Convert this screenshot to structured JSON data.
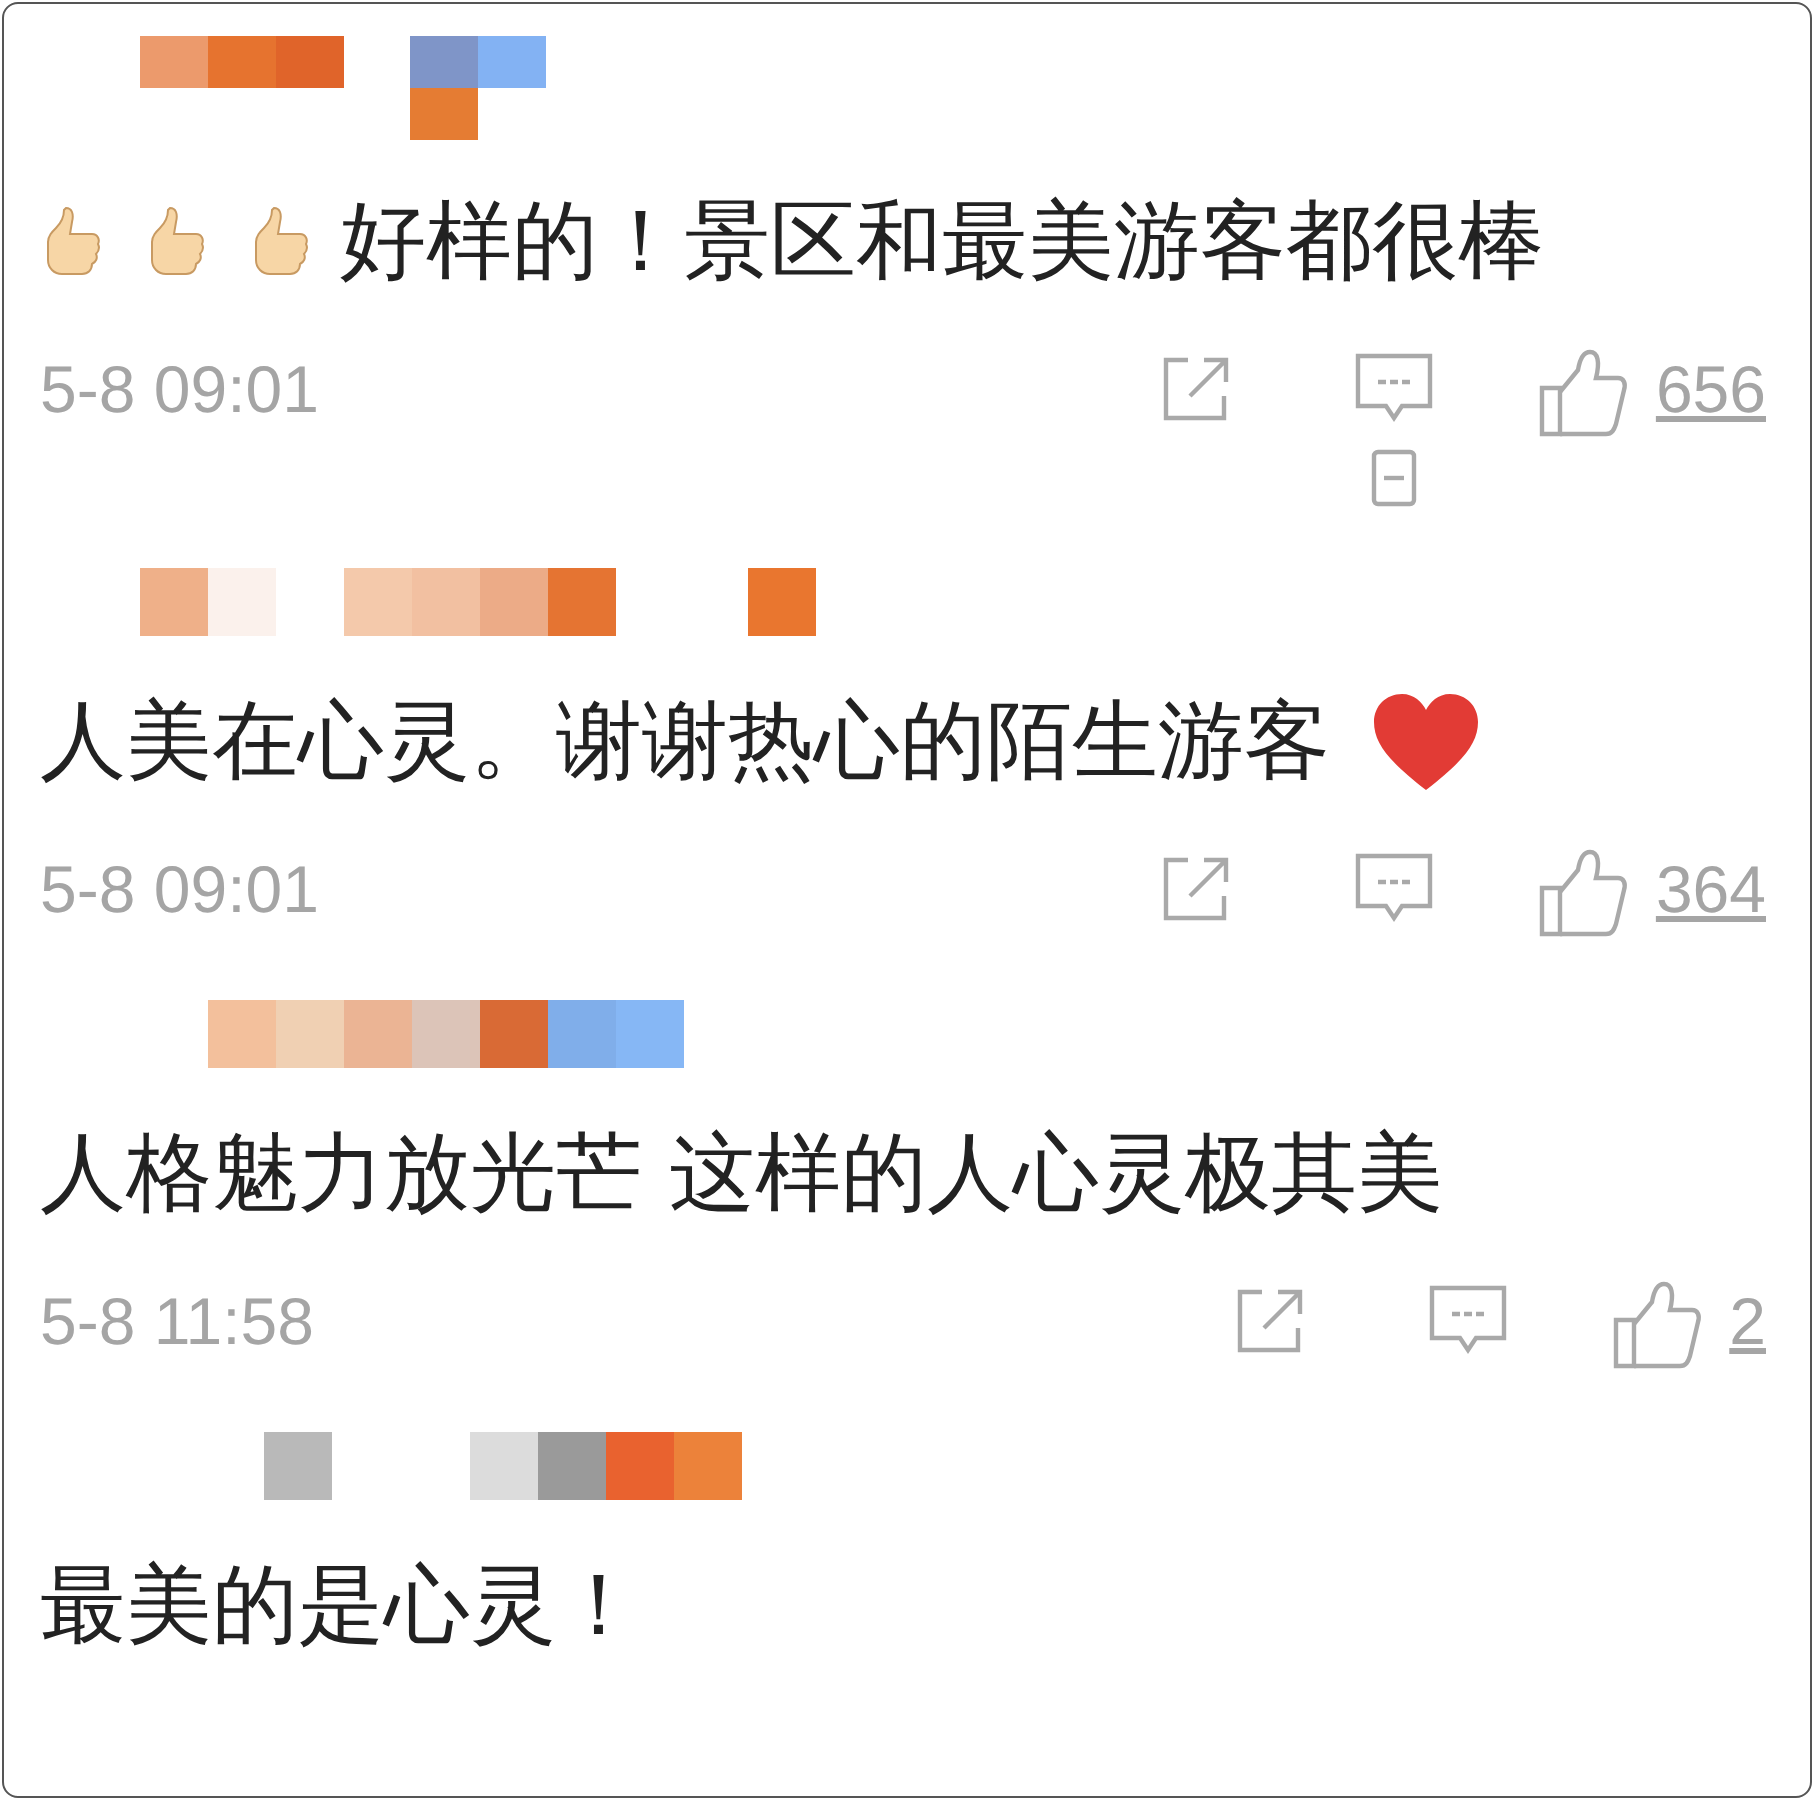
{
  "comments": [
    {
      "author": {
        "kind": "picture"
      },
      "lead_emojis": [
        {
          "kind": "thumbs_up"
        },
        {
          "kind": "thumbs_up"
        },
        {
          "kind": "thumbs_up"
        }
      ],
      "text": "好样的！景区和最美游客都很棒",
      "time": "5-8 09:01",
      "likes": "656",
      "minus_box": true
    },
    {
      "author": {
        "kind": "picture"
      },
      "text": "人美在心灵。谢谢热心的陌生游客",
      "trail_emojis": [
        {
          "kind": "heart"
        }
      ],
      "time": "5-8 09:01",
      "likes": "364",
      "minus_box": false
    },
    {
      "author": {
        "kind": "picture"
      },
      "text": "人格魅力放光芒 这样的人心灵极其美",
      "time": "5-8 11:58",
      "likes": "2",
      "minus_box": false
    },
    {
      "author": {
        "kind": "picture"
      },
      "text": "最美的是心灵！"
    }
  ]
}
